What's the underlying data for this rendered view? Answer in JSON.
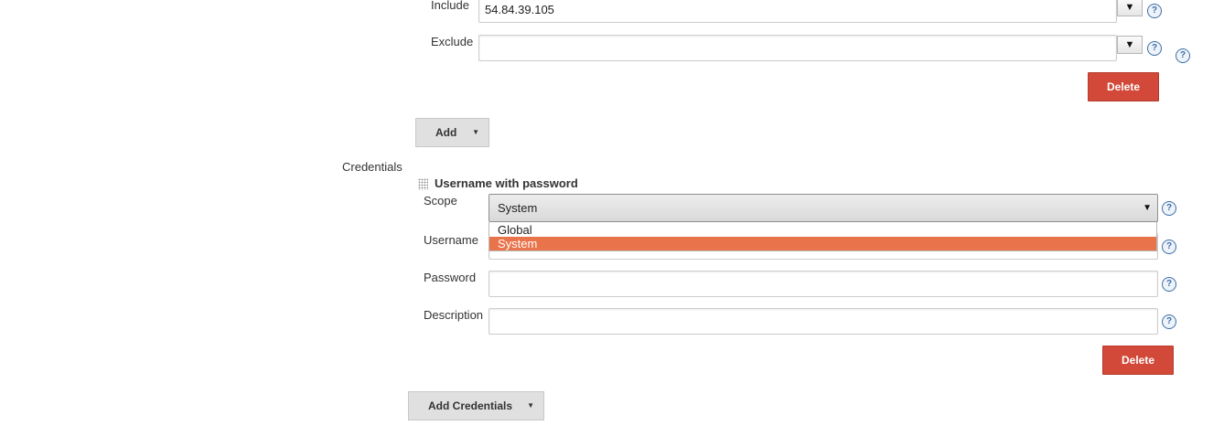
{
  "host_filter": {
    "include_label": "Include",
    "include_value": "54.84.39.105",
    "exclude_label": "Exclude",
    "exclude_value": "",
    "delete_label": "Delete",
    "add_label": "Add"
  },
  "credentials": {
    "section_label": "Credentials",
    "type_title": "Username with password",
    "scope_label": "Scope",
    "scope_selected": "System",
    "scope_options": [
      "Global",
      "System"
    ],
    "username_label": "Username",
    "username_value": "",
    "password_label": "Password",
    "password_value": "",
    "description_label": "Description",
    "description_value": "",
    "delete_label": "Delete",
    "add_label": "Add Credentials"
  },
  "icons": {
    "help": "?",
    "dropdown": "▼",
    "caret": "▼"
  },
  "colors": {
    "delete_button": "#d24939",
    "selected_option": "#e9734a",
    "help_icon": "#3b6ea5"
  }
}
